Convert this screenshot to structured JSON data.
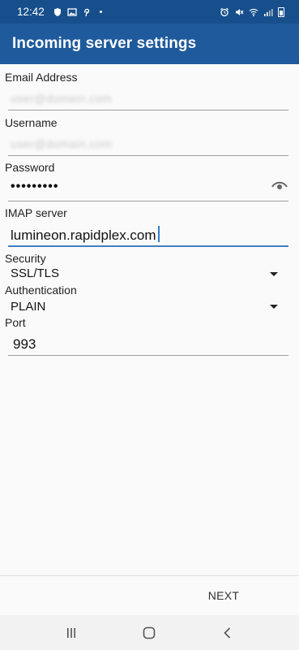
{
  "status_bar": {
    "time": "12:42",
    "left_icons": [
      "shield-icon",
      "image-icon",
      "pinterest-icon",
      "dot-icon"
    ],
    "right_icons": [
      "alarm-icon",
      "mute-icon",
      "wifi-icon",
      "signal-icon",
      "battery-icon"
    ]
  },
  "app_bar": {
    "title": "Incoming server settings",
    "color": "#1e5a9c"
  },
  "form": {
    "email": {
      "label": "Email Address",
      "value": "user@domain.com"
    },
    "username": {
      "label": "Username",
      "value": "user@domain.com"
    },
    "password": {
      "label": "Password",
      "value": "•••••••••",
      "toggle_icon": "eye-icon"
    },
    "imap": {
      "label": "IMAP server",
      "value": "lumineon.rapidplex.com"
    },
    "security": {
      "label": "Security",
      "value": "SSL/TLS"
    },
    "authentication": {
      "label": "Authentication",
      "value": "PLAIN"
    },
    "port": {
      "label": "Port",
      "value": "993"
    }
  },
  "actions": {
    "next_label": "NEXT"
  },
  "nav_bar": {
    "icons": [
      "recents-icon",
      "home-icon",
      "back-icon"
    ]
  }
}
